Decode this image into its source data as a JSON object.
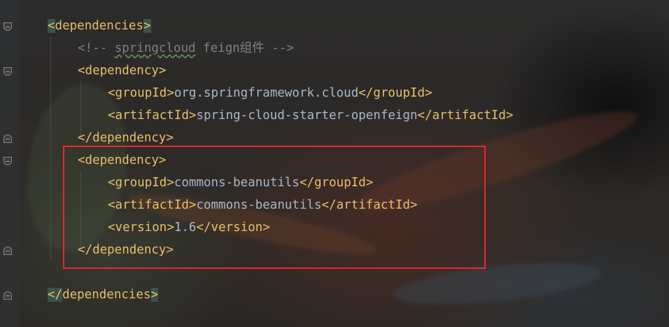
{
  "editor": {
    "language": "xml",
    "lines": [
      {
        "indent": 0,
        "open": "<",
        "tag_open": "dependencies",
        "close": ">",
        "highlight": true
      },
      {
        "indent": 1,
        "comment": "<!-- springcloud feign组件 -->"
      },
      {
        "indent": 1,
        "open": "<",
        "tag_open": "dependency",
        "close": ">"
      },
      {
        "indent": 2,
        "open": "<",
        "tag_open": "groupId",
        "close": ">",
        "text": "org.springframework.cloud",
        "end_open": "</",
        "tag_close": "groupId",
        "end_close": ">"
      },
      {
        "indent": 2,
        "open": "<",
        "tag_open": "artifactId",
        "close": ">",
        "text": "spring-cloud-starter-openfeign",
        "end_open": "</",
        "tag_close": "artifactId",
        "end_close": ">"
      },
      {
        "indent": 1,
        "open": "</",
        "tag_open": "dependency",
        "close": ">"
      },
      {
        "indent": 1,
        "open": "<",
        "tag_open": "dependency",
        "close": ">"
      },
      {
        "indent": 2,
        "open": "<",
        "tag_open": "groupId",
        "close": ">",
        "text": "commons-beanutils",
        "end_open": "</",
        "tag_close": "groupId",
        "end_close": ">"
      },
      {
        "indent": 2,
        "open": "<",
        "tag_open": "artifactId",
        "close": ">",
        "text": "commons-beanutils",
        "end_open": "</",
        "tag_close": "artifactId",
        "end_close": ">"
      },
      {
        "indent": 2,
        "open": "<",
        "tag_open": "version",
        "close": ">",
        "text": "1.6",
        "end_open": "</",
        "tag_close": "version",
        "end_close": ">"
      },
      {
        "indent": 1,
        "open": "</",
        "tag_open": "dependency",
        "close": ">"
      },
      {
        "indent": 0,
        "blank": true
      },
      {
        "indent": 0,
        "open": "</",
        "tag_open": "dependencies",
        "close": ">",
        "highlight": true
      }
    ]
  },
  "colors": {
    "tag": "#e8bf6a",
    "text": "#a9b7c6",
    "comment": "#808080",
    "annotation_box": "#e8292c",
    "brace_highlight": "#3b514d"
  },
  "icons": [
    "fold-open-icon",
    "fold-close-icon"
  ]
}
